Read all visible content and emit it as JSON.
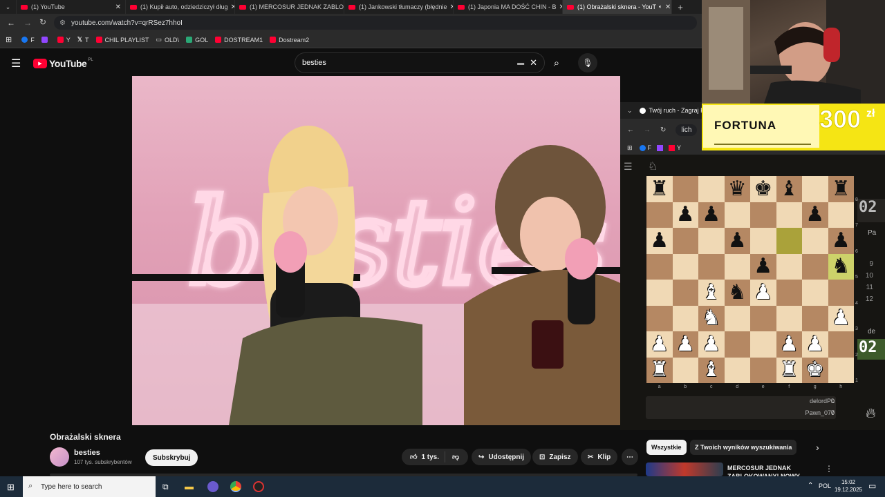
{
  "browser": {
    "tabs": [
      {
        "label": "(1) YouTube",
        "active": false
      },
      {
        "label": "(1) Kupił auto, odziedziczył dług",
        "active": false
      },
      {
        "label": "(1) MERCOSUR JEDNAK ZABLOKO",
        "active": false
      },
      {
        "label": "(1) Jankowski tłumaczy (błędnie",
        "active": false
      },
      {
        "label": "(1) Japonia MA DOŚĆ CHIN - B",
        "active": false
      },
      {
        "label": "(1) Obrażalski sknera - YouT",
        "active": true
      }
    ],
    "url": "youtube.com/watch?v=qrRSez7hhoI",
    "bookmarks": [
      {
        "label": "F",
        "color": "#1877f2"
      },
      {
        "label": "",
        "color": "#9146ff"
      },
      {
        "label": "Y",
        "color": "#ff0033"
      },
      {
        "label": "T",
        "color": "#ffffff"
      },
      {
        "label": "CHIL PLAYLIST",
        "color": "#ff0033"
      },
      {
        "label": "OLD\\",
        "color": "#bbbbbb"
      },
      {
        "label": "GOL",
        "color": "#2aa876"
      },
      {
        "label": "DOSTREAM1",
        "color": "#ff0033"
      },
      {
        "label": "Dostream2",
        "color": "#ff0033"
      }
    ]
  },
  "youtube": {
    "logo": "YouTube",
    "country": "PL",
    "search_value": "besties",
    "video_title": "Obrażalski sknera",
    "channel_name": "besties",
    "subscribers": "107 tys. subskrybentów",
    "subscribe_label": "Subskrybuj",
    "likes": "1 tys.",
    "share_label": "Udostępnij",
    "save_label": "Zapisz",
    "clip_label": "Klip",
    "neon_text": "besties"
  },
  "chess": {
    "tab_title": "Twój ruch - Zagraj P",
    "url_fragment": "lich",
    "players": [
      {
        "name": "delordPL",
        "score": "0"
      },
      {
        "name": "Pawn_077",
        "score": "0"
      }
    ],
    "clock_top": "02",
    "clock_bottom": "02",
    "move_numbers": [
      "9",
      "10",
      "11",
      "12"
    ],
    "files": [
      "a",
      "b",
      "c",
      "d",
      "e",
      "f",
      "g",
      "h"
    ],
    "ranks": [
      "8",
      "7",
      "6",
      "5",
      "4",
      "3",
      "2",
      "1"
    ],
    "side_label_top": "Pa",
    "side_label_bottom": "de",
    "board": [
      [
        "r",
        "",
        "",
        "q",
        "k",
        "b",
        "",
        "r"
      ],
      [
        "",
        "p",
        "p",
        "",
        "",
        "",
        "p",
        ""
      ],
      [
        "p",
        "",
        "",
        "p",
        "",
        "",
        "",
        "p"
      ],
      [
        "",
        "",
        "",
        "",
        "p",
        "",
        "",
        "n"
      ],
      [
        "",
        "",
        "B",
        "n",
        "P",
        "",
        "",
        ""
      ],
      [
        "",
        "",
        "N",
        "",
        "",
        "",
        "",
        "P"
      ],
      [
        "P",
        "P",
        "P",
        "",
        "",
        "P",
        "P",
        ""
      ],
      [
        "R",
        "",
        "B",
        "",
        "",
        "R",
        "K",
        ""
      ]
    ]
  },
  "sidebar": {
    "chip_all": "Wszystkie",
    "chip_search": "Z Twoich wyników wyszukiwania",
    "rec_title_1": "MERCOSUR JEDNAK",
    "rec_title_2": "ZABLOKOWANY! NOWY"
  },
  "ad": {
    "brand": "FORTUNA",
    "amount": "300",
    "currency": "zł"
  },
  "taskbar": {
    "search_placeholder": "Type here to search",
    "lang": "POL",
    "time": "15:02",
    "date": "19.12.2025"
  }
}
